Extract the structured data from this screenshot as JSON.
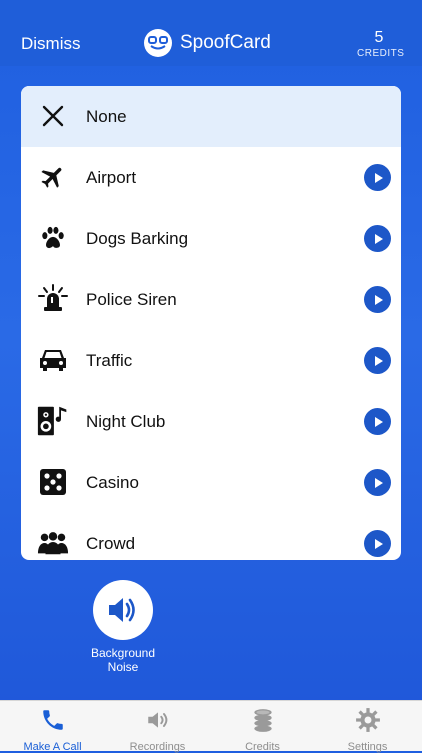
{
  "header": {
    "dismiss_label": "Dismiss",
    "brand_name": "SpoofCard",
    "credits_count": "5",
    "credits_label": "CREDITS"
  },
  "noise_list": {
    "items": [
      {
        "label": "None",
        "icon": "close-icon",
        "selected": true
      },
      {
        "label": "Airport",
        "icon": "airplane-icon"
      },
      {
        "label": "Dogs Barking",
        "icon": "paw-icon"
      },
      {
        "label": "Police Siren",
        "icon": "siren-icon"
      },
      {
        "label": "Traffic",
        "icon": "car-icon"
      },
      {
        "label": "Night Club",
        "icon": "speaker-music-icon"
      },
      {
        "label": "Casino",
        "icon": "dice-icon"
      },
      {
        "label": "Crowd",
        "icon": "crowd-icon"
      }
    ]
  },
  "background_noise": {
    "label_line1": "Background",
    "label_line2": "Noise",
    "icon": "speaker-icon"
  },
  "tabbar": {
    "tabs": [
      {
        "label": "Make A Call",
        "icon": "phone-icon",
        "active": true
      },
      {
        "label": "Recordings",
        "icon": "speaker-icon"
      },
      {
        "label": "Credits",
        "icon": "coins-icon"
      },
      {
        "label": "Settings",
        "icon": "gear-icon"
      }
    ]
  },
  "colors": {
    "primary": "#1f5ed9",
    "accent": "#1d57c8",
    "selected_row": "#e3eefc"
  }
}
